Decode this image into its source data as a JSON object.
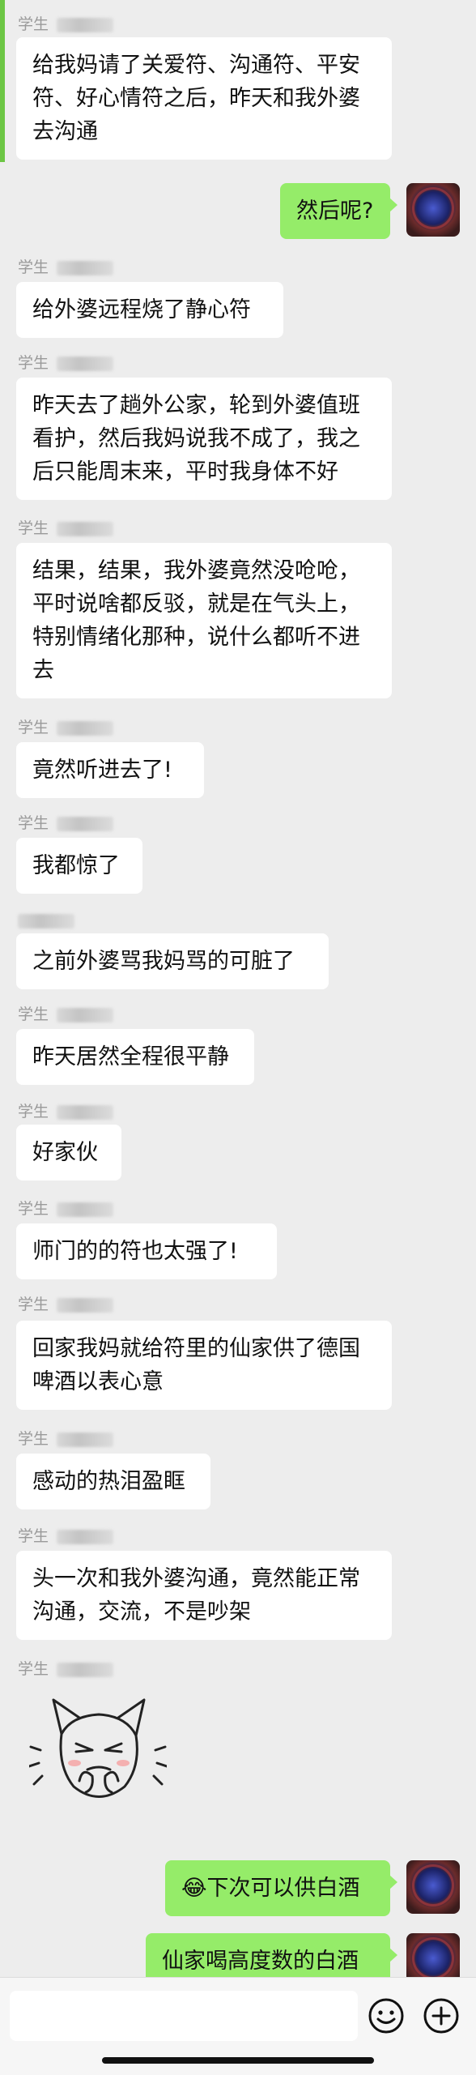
{
  "sender_label": "学生",
  "messages": [
    {
      "id": "m1",
      "side": "left",
      "text": "给我妈请了关爱符、沟通符、平安符、好心情符之后，昨天和我外婆去沟通"
    },
    {
      "id": "m2",
      "side": "right",
      "text": "然后呢?"
    },
    {
      "id": "m3",
      "side": "left",
      "text": "给外婆远程烧了静心符"
    },
    {
      "id": "m4",
      "side": "left",
      "text": "昨天去了趟外公家，轮到外婆值班看护，然后我妈说我不成了，我之后只能周末来，平时我身体不好"
    },
    {
      "id": "m5",
      "side": "left",
      "text": "结果，结果，我外婆竟然没呛呛，平时说啥都反驳，就是在气头上，特别情绪化那种，说什么都听不进去"
    },
    {
      "id": "m6",
      "side": "left",
      "text": "竟然听进去了!"
    },
    {
      "id": "m7",
      "side": "left",
      "text": "我都惊了"
    },
    {
      "id": "m8",
      "side": "left",
      "text": "之前外婆骂我妈骂的可脏了"
    },
    {
      "id": "m9",
      "side": "left",
      "text": "昨天居然全程很平静"
    },
    {
      "id": "m10",
      "side": "left",
      "text": "好家伙"
    },
    {
      "id": "m11",
      "side": "left",
      "text": "师门的的符也太强了!"
    },
    {
      "id": "m12",
      "side": "left",
      "text": "回家我妈就给符里的仙家供了德国啤酒以表心意"
    },
    {
      "id": "m13",
      "side": "left",
      "text": "感动的热泪盈眶"
    },
    {
      "id": "m14",
      "side": "left",
      "text": "头一次和我外婆沟通，竟然能正常沟通，交流，不是吵架"
    },
    {
      "id": "m15",
      "side": "left",
      "text": ""
    },
    {
      "id": "m16",
      "side": "right",
      "text": "😂下次可以供白酒"
    },
    {
      "id": "m17",
      "side": "right",
      "text": "仙家喝高度数的白酒"
    }
  ],
  "input": {
    "placeholder": ""
  },
  "icons": {
    "emoji": "emoji-icon",
    "add": "plus-circle-icon"
  },
  "colors": {
    "bubble_self": "#95ec69",
    "bubble_other": "#ffffff",
    "background": "#ededed"
  }
}
